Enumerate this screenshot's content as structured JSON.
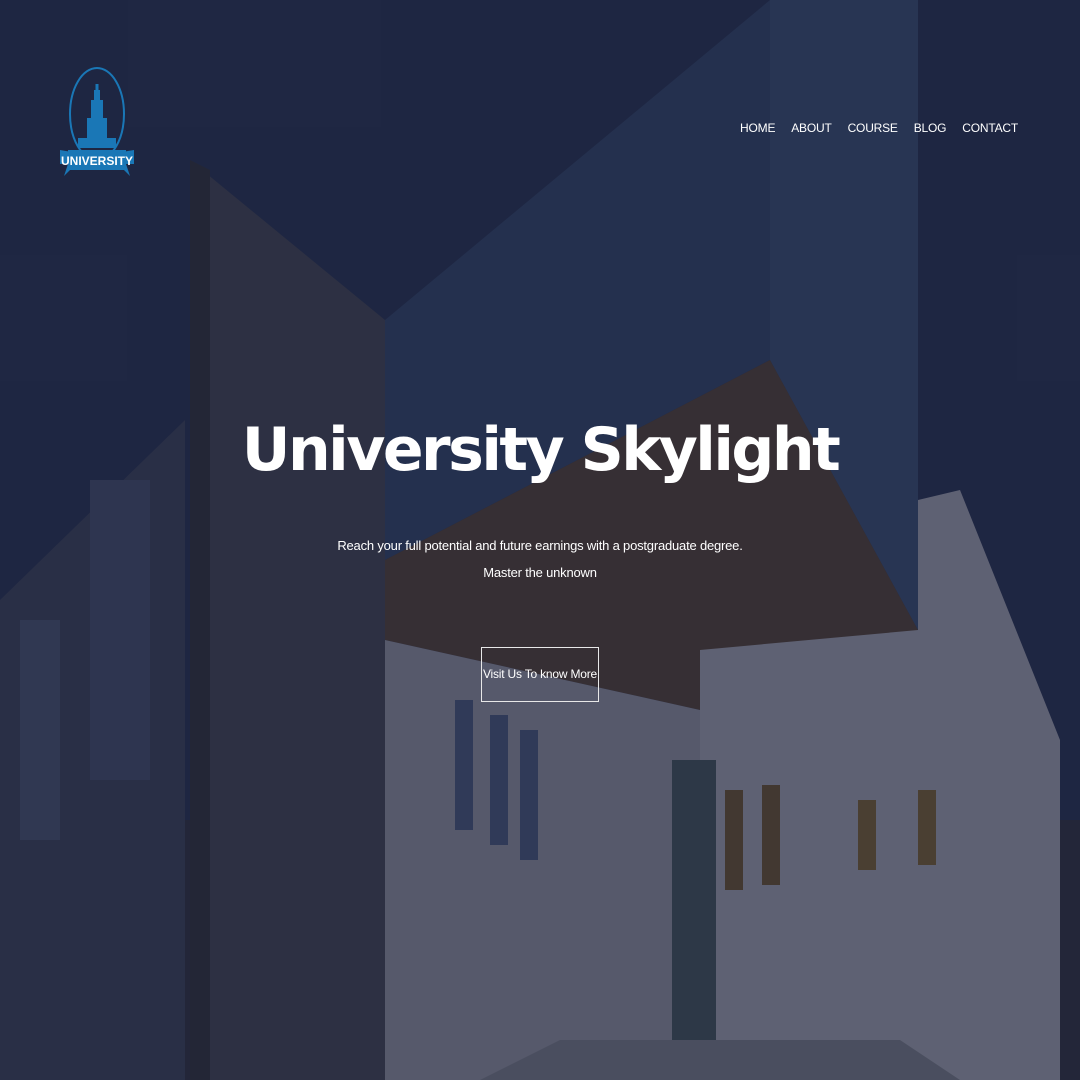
{
  "logo": {
    "text": "UNIVERSITY",
    "icon": "university-tower-icon",
    "color": "#1a77b6"
  },
  "nav": {
    "items": [
      {
        "label": "HOME"
      },
      {
        "label": "ABOUT"
      },
      {
        "label": "COURSE"
      },
      {
        "label": "BLOG"
      },
      {
        "label": "CONTACT"
      }
    ]
  },
  "hero": {
    "title": "University Skylight",
    "subtitle_line1": "Reach your full potential and future earnings with a postgraduate degree.",
    "subtitle_line2": "Master the unknown",
    "cta_label": "Visit Us To know More"
  }
}
